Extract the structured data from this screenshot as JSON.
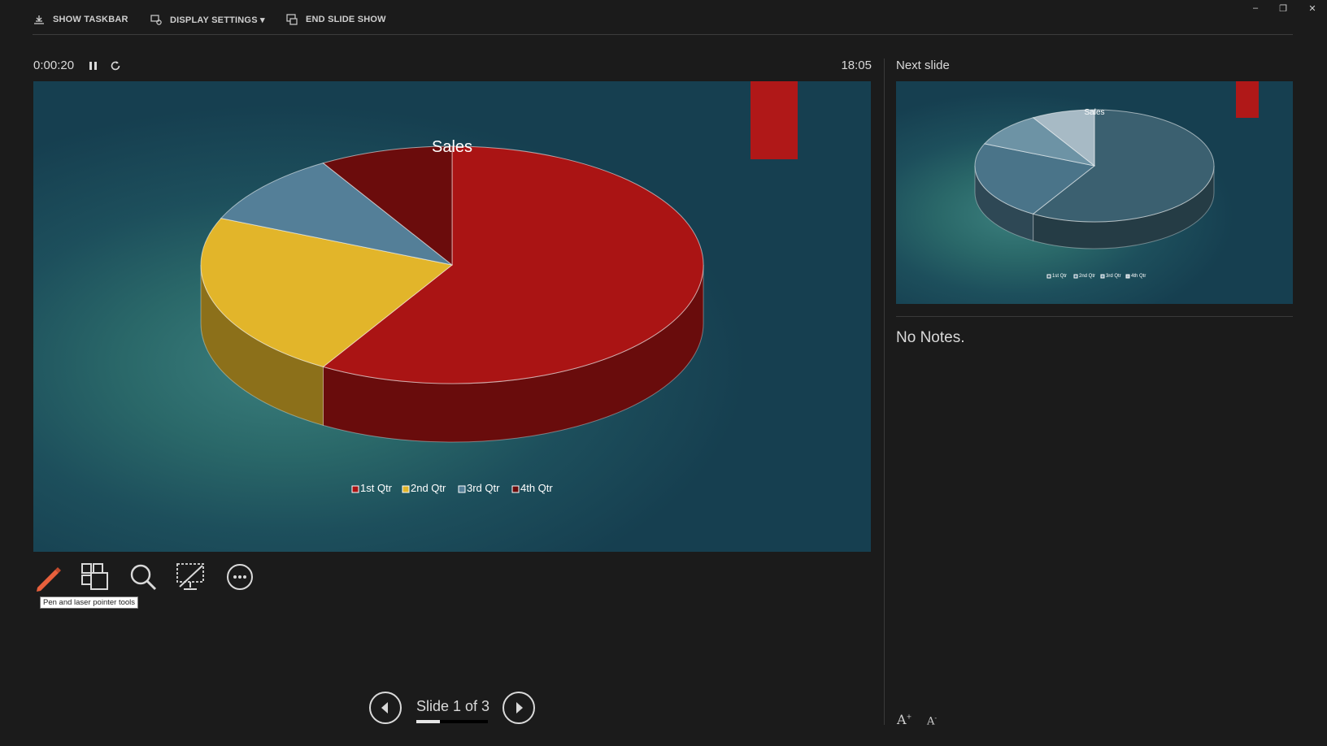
{
  "toolbar": {
    "show_taskbar": "SHOW TASKBAR",
    "display_settings": "DISPLAY SETTINGS ▾",
    "end_slide_show": "END SLIDE SHOW"
  },
  "window_controls": {
    "minimize": "–",
    "restore": "❐",
    "close": "✕"
  },
  "timer": {
    "elapsed": "0:00:20",
    "clock": "18:05"
  },
  "current_slide": {
    "chart_data": {
      "type": "pie",
      "style": "3d",
      "title": "Sales",
      "categories": [
        "1st Qtr",
        "2nd Qtr",
        "3rd Qtr",
        "4th Qtr"
      ],
      "values": [
        8.2,
        3.2,
        1.4,
        1.2
      ],
      "colors": [
        "#aa1414",
        "#e2b52a",
        "#547f98",
        "#6b0c0c"
      ],
      "legend": "bottom"
    },
    "accent_color": "#b01818"
  },
  "next_slide": {
    "label": "Next slide",
    "chart_data": {
      "type": "pie",
      "style": "3d",
      "title": "Sales",
      "categories": [
        "1st Qtr",
        "2nd Qtr",
        "3rd Qtr",
        "4th Qtr"
      ],
      "values": [
        8.2,
        3.2,
        1.4,
        1.2
      ],
      "colors": [
        "#3b6070",
        "#4a7489",
        "#6d93a5",
        "#a7bac5"
      ],
      "legend": "bottom"
    }
  },
  "notes": {
    "text": "No Notes."
  },
  "tools": {
    "pen": "pen-laser-icon",
    "see_all": "see-all-slides-icon",
    "zoom": "zoom-icon",
    "black_screen": "black-screen-icon",
    "more": "more-options-icon",
    "tooltip": "Pen and laser pointer tools"
  },
  "navigation": {
    "slide_counter": "Slide 1 of 3",
    "progress": 0.33
  },
  "font_controls": {
    "increase": "A",
    "decrease": "A"
  }
}
